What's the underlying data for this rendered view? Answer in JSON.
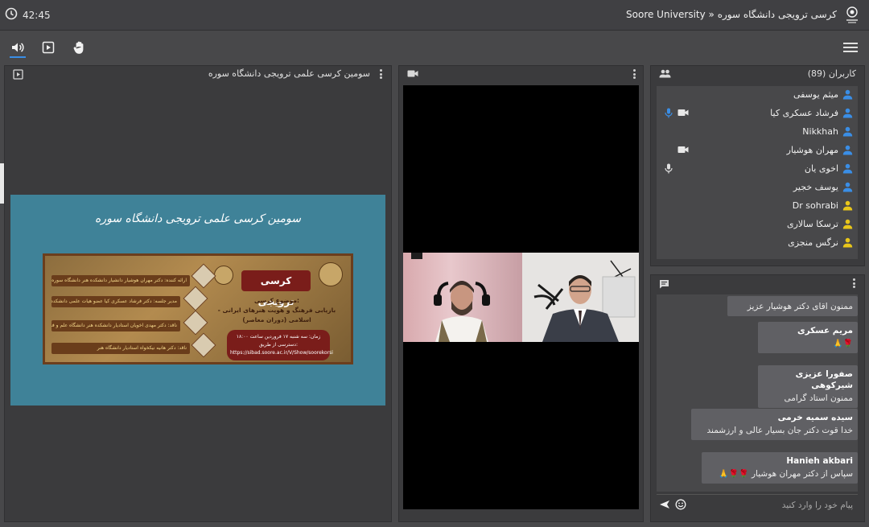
{
  "topbar": {
    "clock_time": "42:45",
    "title": "Soore University » کرسی ترویجی دانشگاه سوره"
  },
  "toolbar": {
    "icons": [
      "speaker-icon",
      "present-icon",
      "raise-hand-icon",
      "menu-icon"
    ]
  },
  "presentation": {
    "title": "سومین کرسی علمی ترویجی دانشگاه سوره",
    "slide_heading": "سومین کرسی علمی ترویجی دانشگاه سوره",
    "poster": {
      "badge": "کرسی ترویجی",
      "topic_label": "موضوع کرسی:",
      "topic": "بازیابی فرهنگ و هویت هنرهای ایرانی - اسلامی (دوران معاصر)",
      "presenter": "ارائه کننده: دکتر مهران هوشیار دانشیار دانشکده هنر دانشگاه سوره",
      "chair": "مدیر جلسه: دکتر فرشاد عسکری کیا عضو هیات علمی دانشکده هنر دانشگاه سوره",
      "critic1": "ناقد: دکتر مهدی اخویان استادیار دانشکده هنر دانشگاه علم و فرهنگ",
      "critic2": "ناقد: دکتر هانیه نیکخواه استادیار دانشگاه هنر",
      "time": "زمان: سه شنبه ۱۷ فروردین ساعت ۱۸:۰۰",
      "access": "دسترسی از طریق:",
      "url": "https://sibad.soore.ac.ir/V/Show/soorekorsi"
    }
  },
  "users": {
    "title": "کاربران (89)",
    "list": [
      {
        "name": "میثم یوسفی",
        "color": "#3a8ee6",
        "mic": false,
        "cam": false
      },
      {
        "name": "فرشاد عسکری کیا",
        "color": "#3a8ee6",
        "mic": true,
        "cam": true
      },
      {
        "name": "Nikkhah",
        "color": "#3a8ee6",
        "mic": false,
        "cam": false
      },
      {
        "name": "مهران هوشیار",
        "color": "#3a8ee6",
        "mic": false,
        "cam": true
      },
      {
        "name": "اخوی یان",
        "color": "#3a8ee6",
        "mic": true,
        "cam": false
      },
      {
        "name": "یوسف خجیر",
        "color": "#3a8ee6",
        "mic": false,
        "cam": false
      },
      {
        "name": "Dr sohrabi",
        "color": "#e8c61a",
        "mic": false,
        "cam": false
      },
      {
        "name": "ترسکا سالاری",
        "color": "#e8c61a",
        "mic": false,
        "cam": false
      },
      {
        "name": "نرگس منجزی",
        "color": "#e8c61a",
        "mic": false,
        "cam": false
      }
    ]
  },
  "chat": {
    "messages": [
      {
        "name": "",
        "text": "ممنون اقای دکتر هوشیار عزیز",
        "emojis": ""
      },
      {
        "name": "مریم عسکری",
        "text": "",
        "emojis": "🌹🙏"
      },
      {
        "name": "صفورا عزیزی شیرکوهی",
        "text": "ممنون استاد گرامی",
        "emojis": ""
      },
      {
        "name": "سیده سمیه خرمی",
        "text": "خدا قوت دکتر جان بسیار عالی و ارزشمند",
        "emojis": ""
      },
      {
        "name": "Hanieh akbari",
        "text": "سپاس از دکتر مهران هوشیار",
        "emojis": "🌹🌹🙏"
      }
    ],
    "input_placeholder": "پیام خود را وارد کنید"
  }
}
